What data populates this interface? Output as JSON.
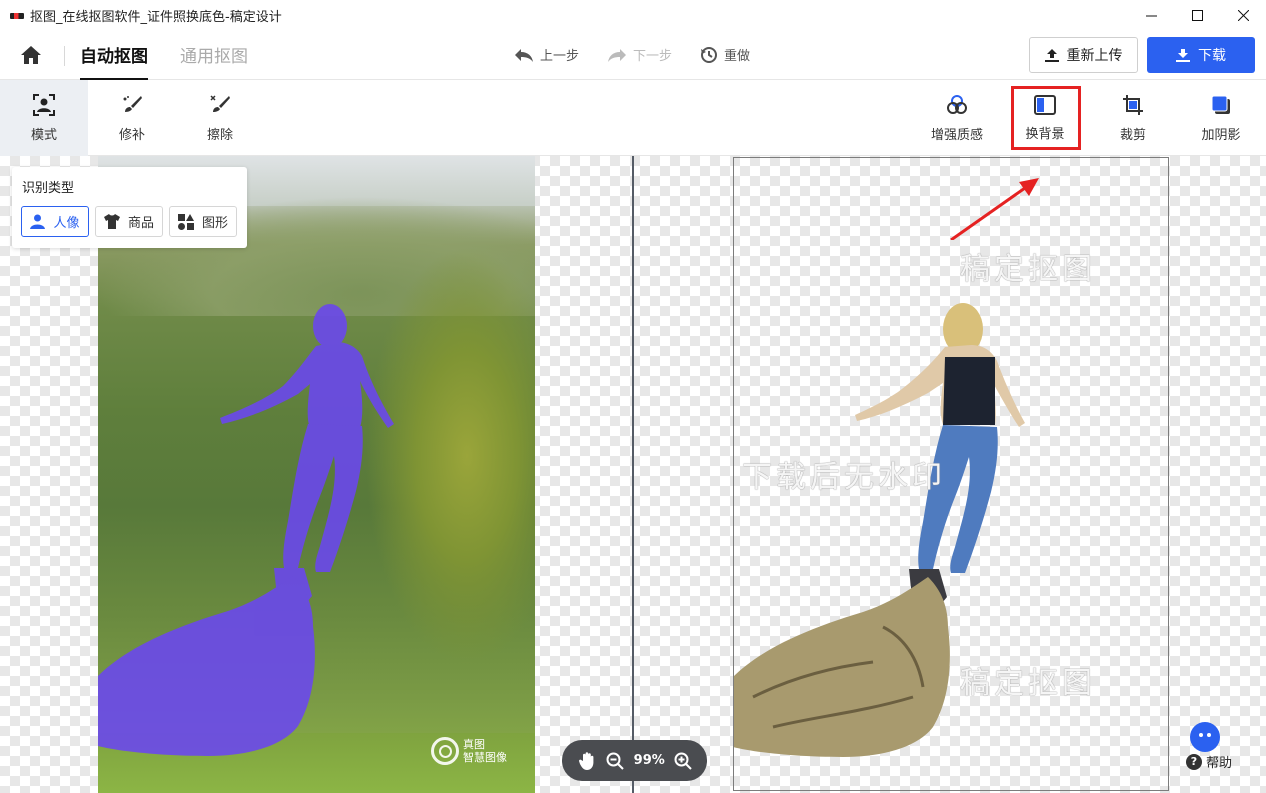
{
  "window": {
    "title": "抠图_在线抠图软件_证件照换底色-稿定设计",
    "controls": [
      "minimize",
      "maximize",
      "close"
    ]
  },
  "header": {
    "tabs": [
      {
        "label": "自动抠图",
        "active": true
      },
      {
        "label": "通用抠图",
        "active": false
      }
    ],
    "undo_label": "上一步",
    "redo_label": "下一步",
    "reset_label": "重做",
    "reupload_label": "重新上传",
    "download_label": "下载"
  },
  "toolbar": {
    "left_tools": [
      {
        "label": "模式",
        "icon": "portrait-mode-icon",
        "active": true
      },
      {
        "label": "修补",
        "icon": "brush-icon",
        "active": false
      },
      {
        "label": "擦除",
        "icon": "eraser-icon",
        "active": false
      }
    ],
    "right_tools": [
      {
        "label": "增强质感",
        "icon": "enhance-icon"
      },
      {
        "label": "换背景",
        "icon": "background-icon",
        "highlighted": true
      },
      {
        "label": "裁剪",
        "icon": "crop-icon"
      },
      {
        "label": "加阴影",
        "icon": "shadow-icon"
      }
    ]
  },
  "type_panel": {
    "title": "识别类型",
    "options": [
      {
        "label": "人像",
        "icon": "person-icon",
        "active": true
      },
      {
        "label": "商品",
        "icon": "tshirt-icon",
        "active": false
      },
      {
        "label": "图形",
        "icon": "shapes-icon",
        "active": false
      }
    ]
  },
  "watermarks": {
    "top": "稿定抠图",
    "middle": "下载后无水印",
    "bottom": "稿定抠图"
  },
  "photo_logo": {
    "line1": "真图",
    "line2": "智慧图像"
  },
  "zoom": {
    "value": "99%"
  },
  "help_label": "帮助",
  "colors": {
    "accent": "#2b61f0",
    "highlight": "#e52222",
    "mask": "#6a48ec"
  }
}
